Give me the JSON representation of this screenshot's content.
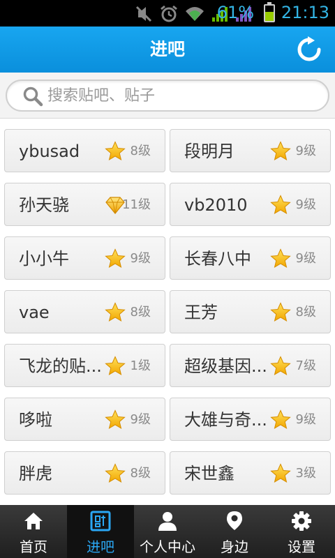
{
  "status_bar": {
    "battery_pct": "61%",
    "battery_level": 0.61,
    "time": "21:13",
    "icons": [
      "mute-icon",
      "alarm-icon",
      "wifi-icon",
      "signal-icon",
      "signal-icon"
    ]
  },
  "header": {
    "title": "进吧"
  },
  "search": {
    "placeholder": "搜索贴吧、贴子"
  },
  "forums": [
    {
      "name": "ybusad",
      "badge": "star",
      "level": "8级"
    },
    {
      "name": "段明月",
      "badge": "star",
      "level": "9级"
    },
    {
      "name": "孙天骁",
      "badge": "diamond",
      "level": "11级"
    },
    {
      "name": "vb2010",
      "badge": "star",
      "level": "9级"
    },
    {
      "name": "小小牛",
      "badge": "star",
      "level": "9级"
    },
    {
      "name": "长春八中",
      "badge": "star",
      "level": "9级"
    },
    {
      "name": "vae",
      "badge": "star",
      "level": "8级"
    },
    {
      "name": "王芳",
      "badge": "star",
      "level": "8级"
    },
    {
      "name": "飞龙的贴...",
      "badge": "star",
      "level": "1级"
    },
    {
      "name": "超级基因...",
      "badge": "star",
      "level": "7级"
    },
    {
      "name": "哆啦",
      "badge": "star",
      "level": "9级"
    },
    {
      "name": "大雄与奇...",
      "badge": "star",
      "level": "9级"
    },
    {
      "name": "胖虎",
      "badge": "star",
      "level": "8级"
    },
    {
      "name": "宋世鑫",
      "badge": "star",
      "level": "3级"
    }
  ],
  "nav": {
    "items": [
      {
        "label": "首页",
        "icon": "home-icon",
        "active": false
      },
      {
        "label": "进吧",
        "icon": "forum-icon",
        "active": true
      },
      {
        "label": "个人中心",
        "icon": "person-icon",
        "active": false
      },
      {
        "label": "身边",
        "icon": "location-icon",
        "active": false
      },
      {
        "label": "设置",
        "icon": "gear-icon",
        "active": false
      }
    ]
  },
  "colors": {
    "header_blue": "#0e97e6",
    "active_nav": "#2aa7f4",
    "star": "#f5b800"
  }
}
